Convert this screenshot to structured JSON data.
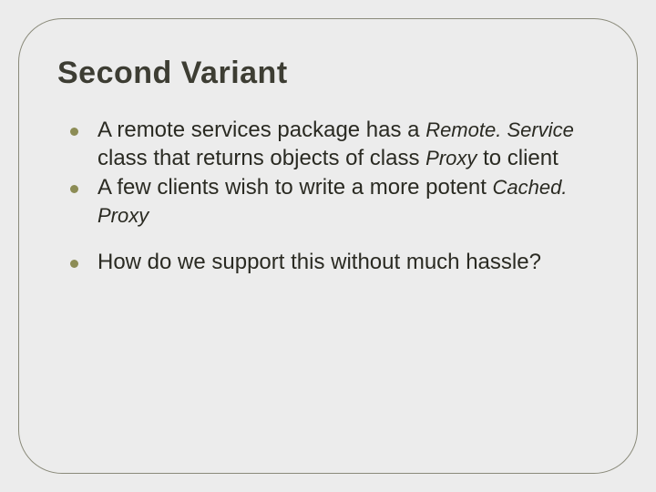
{
  "slide": {
    "title": "Second Variant",
    "bullets": [
      {
        "pre1": "A remote services package has a ",
        "code1": "Remote. Service",
        "mid1": " class that returns objects of class ",
        "code2": "Proxy",
        "post1": " to client"
      },
      {
        "pre1": "A few clients wish to write a more potent ",
        "code1": "Cached. Proxy"
      },
      {
        "pre1": "How do we support this without much hassle?"
      }
    ]
  }
}
